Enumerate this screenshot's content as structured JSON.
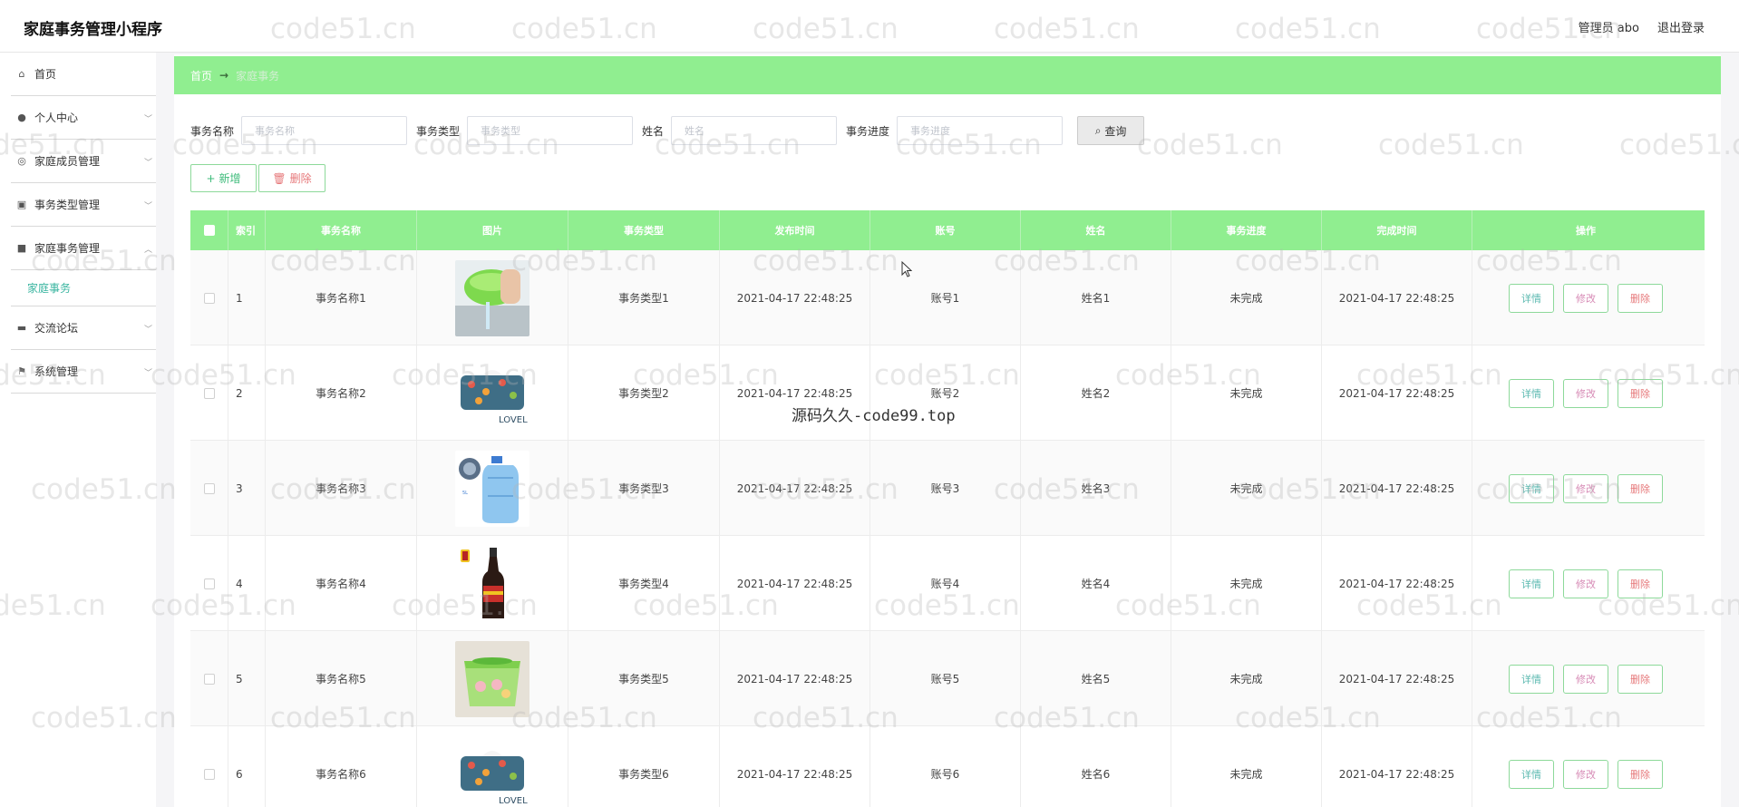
{
  "app": {
    "title": "家庭事务管理小程序",
    "user_label": "管理员 abo",
    "logout_label": "退出登录"
  },
  "sidebar": {
    "items": [
      {
        "label": "首页",
        "icon": "home-icon"
      },
      {
        "label": "个人中心",
        "icon": "user-icon"
      },
      {
        "label": "家庭成员管理",
        "icon": "dashboard-icon"
      },
      {
        "label": "事务类型管理",
        "icon": "clipboard-icon"
      },
      {
        "label": "家庭事务管理",
        "icon": "briefcase-icon"
      },
      {
        "label": "交流论坛",
        "icon": "chat-icon"
      },
      {
        "label": "系统管理",
        "icon": "flag-icon"
      }
    ],
    "sub_item": "家庭事务"
  },
  "breadcrumb": {
    "home": "首页",
    "arrow": "→",
    "current": "家庭事务"
  },
  "search": {
    "name_label": "事务名称",
    "name_placeholder": "事务名称",
    "type_label": "事务类型",
    "type_placeholder": "事务类型",
    "user_label": "姓名",
    "user_placeholder": "姓名",
    "progress_label": "事务进度",
    "progress_placeholder": "事务进度",
    "button_label": "查询"
  },
  "actions": {
    "add_label": "新增",
    "delete_label": "删除"
  },
  "table": {
    "headers": {
      "index": "索引",
      "name": "事务名称",
      "image": "图片",
      "type": "事务类型",
      "publish_time": "发布时间",
      "account": "账号",
      "user_name": "姓名",
      "progress": "事务进度",
      "finish_time": "完成时间",
      "ops": "操作"
    },
    "row_ops": {
      "detail": "详情",
      "edit": "修改",
      "delete": "删除"
    },
    "rows": [
      {
        "index": "1",
        "name": "事务名称1",
        "image": "strainer-image",
        "type": "事务类型1",
        "publish_time": "2021-04-17 22:48:25",
        "account": "账号1",
        "user_name": "姓名1",
        "progress": "未完成",
        "finish_time": "2021-04-17 22:48:25"
      },
      {
        "index": "2",
        "name": "事务名称2",
        "image": "tissue-box-image",
        "type": "事务类型2",
        "publish_time": "2021-04-17 22:48:25",
        "account": "账号2",
        "user_name": "姓名2",
        "progress": "未完成",
        "finish_time": "2021-04-17 22:48:25"
      },
      {
        "index": "3",
        "name": "事务名称3",
        "image": "water-bottle-image",
        "type": "事务类型3",
        "publish_time": "2021-04-17 22:48:25",
        "account": "账号3",
        "user_name": "姓名3",
        "progress": "未完成",
        "finish_time": "2021-04-17 22:48:25"
      },
      {
        "index": "4",
        "name": "事务名称4",
        "image": "sauce-bottle-image",
        "type": "事务类型4",
        "publish_time": "2021-04-17 22:48:25",
        "account": "账号4",
        "user_name": "姓名4",
        "progress": "未完成",
        "finish_time": "2021-04-17 22:48:25"
      },
      {
        "index": "5",
        "name": "事务名称5",
        "image": "basket-image",
        "type": "事务类型5",
        "publish_time": "2021-04-17 22:48:25",
        "account": "账号5",
        "user_name": "姓名5",
        "progress": "未完成",
        "finish_time": "2021-04-17 22:48:25"
      },
      {
        "index": "6",
        "name": "事务名称6",
        "image": "tissue-box-image",
        "type": "事务类型6",
        "publish_time": "2021-04-17 22:48:25",
        "account": "账号6",
        "user_name": "姓名6",
        "progress": "未完成",
        "finish_time": "2021-04-17 22:48:25"
      }
    ]
  },
  "overlay": "源码久久-code99.top",
  "watermark": "code51.cn",
  "colors": {
    "accent": "#90ee90",
    "link": "#3ab5a0",
    "danger": "#e6787a"
  }
}
